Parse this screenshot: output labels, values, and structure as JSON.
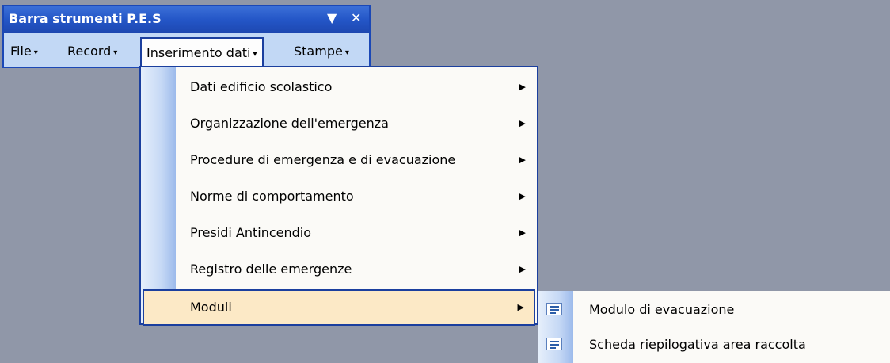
{
  "toolbar": {
    "title": "Barra strumenti P.E.S",
    "options_icon": "triangle-down-icon",
    "close_icon": "close-icon",
    "menus": [
      {
        "label": "File",
        "arrow": "▾"
      },
      {
        "label": "Record",
        "arrow": "▾"
      },
      {
        "label": "Inserimento dati",
        "arrow": "▾"
      },
      {
        "label": "Stampe",
        "arrow": "▾"
      }
    ]
  },
  "dropdown": {
    "items": [
      {
        "label": "Dati edificio scolastico",
        "arrow": "▶"
      },
      {
        "label": "Organizzazione dell'emergenza",
        "arrow": "▶"
      },
      {
        "label": "Procedure di emergenza e di evacuazione",
        "arrow": "▶"
      },
      {
        "label": "Norme di comportamento",
        "arrow": "▶"
      },
      {
        "label": "Presidi Antincendio",
        "arrow": "▶"
      },
      {
        "label": "Registro delle emergenze",
        "arrow": "▶"
      },
      {
        "label": "Moduli",
        "arrow": "▶"
      }
    ]
  },
  "submenu": {
    "items": [
      {
        "label": "Modulo di evacuazione",
        "icon": "form-icon"
      },
      {
        "label": "Scheda riepilogativa area raccolta",
        "icon": "form-icon"
      }
    ]
  },
  "colors": {
    "desktop": "#9097a8",
    "titlebar": "#2456c7",
    "highlight": "#fce9c6",
    "border": "#1b3f9e"
  }
}
